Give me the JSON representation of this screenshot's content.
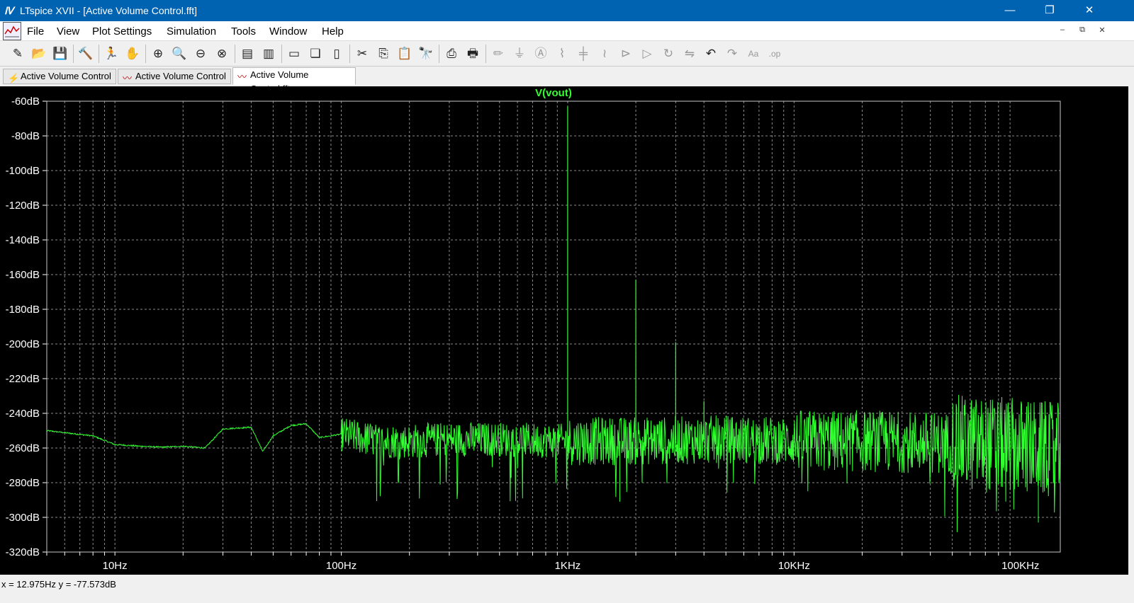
{
  "window": {
    "title": "LTspice XVII - [Active Volume Control.fft]",
    "app_icon": "ltspice-logo-icon"
  },
  "menu": {
    "items": [
      "File",
      "View",
      "Plot Settings",
      "Simulation",
      "Tools",
      "Window",
      "Help"
    ]
  },
  "toolbar": {
    "icons": [
      "new-schematic-icon",
      "open-icon",
      "save-icon",
      "control-panel-icon",
      "run-icon",
      "halt-icon",
      "zoom-in-icon",
      "zoom-area-icon",
      "zoom-out-icon",
      "zoom-fit-icon",
      "autorange-icon",
      "plot-settings-icon",
      "tile-horizontal-icon",
      "cascade-icon",
      "tile-vertical-icon",
      "cut-icon",
      "copy-icon",
      "paste-icon",
      "find-icon",
      "print-preview-icon",
      "print-icon",
      "wire-icon",
      "ground-icon",
      "label-icon",
      "resistor-icon",
      "capacitor-icon",
      "inductor-icon",
      "diode-icon",
      "component-icon",
      "rotate-icon",
      "mirror-icon",
      "undo-icon",
      "redo-icon",
      "text-icon",
      "spice-directive-icon"
    ]
  },
  "tabs": [
    {
      "label": "Active Volume Control",
      "icon": "schematic-icon"
    },
    {
      "label": "Active Volume Control",
      "icon": "waveform-icon"
    },
    {
      "label": "Active Volume Control.fft",
      "icon": "fft-icon"
    }
  ],
  "status": {
    "cursor_readout": "x = 12.975Hz    y = -77.573dB"
  },
  "colors": {
    "trace": "#33ff33",
    "grid": "#8a8a8a",
    "background": "#000000",
    "axis_text": "#ffffff"
  },
  "chart_data": {
    "type": "line",
    "title": "V(vout)",
    "xlabel": "",
    "ylabel": "",
    "x_scale": "log",
    "xlim": [
      5,
      150000
    ],
    "ylim": [
      -320,
      -60
    ],
    "grid": true,
    "x_tick_labels": [
      "10Hz",
      "100Hz",
      "1KHz",
      "10KHz",
      "100KHz"
    ],
    "x_tick_values": [
      10,
      100,
      1000,
      10000,
      100000
    ],
    "y_tick_labels": [
      "-60dB",
      "-80dB",
      "-100dB",
      "-120dB",
      "-140dB",
      "-160dB",
      "-180dB",
      "-200dB",
      "-220dB",
      "-240dB",
      "-260dB",
      "-280dB",
      "-300dB",
      "-320dB"
    ],
    "y_tick_values": [
      -60,
      -80,
      -100,
      -120,
      -140,
      -160,
      -180,
      -200,
      -220,
      -240,
      -260,
      -280,
      -300,
      -320
    ],
    "series": [
      {
        "name": "V(vout)",
        "baseline": {
          "x": [
            5,
            8,
            10,
            13,
            16,
            20,
            25,
            30,
            40,
            45,
            50,
            60,
            70,
            80,
            100,
            150,
            200,
            300,
            500,
            1000,
            2000,
            5000,
            10000,
            20000,
            50000,
            100000,
            150000
          ],
          "y": [
            -250,
            -253,
            -258,
            -259,
            -259.5,
            -259,
            -260,
            -249,
            -248,
            -262,
            -253,
            -247,
            -246,
            -254,
            -252,
            -256,
            -256,
            -255,
            -255,
            -256,
            -256,
            -255,
            -256,
            -256,
            -257,
            -259,
            -262
          ]
        },
        "peaks": [
          {
            "x": 1000,
            "y": -63
          },
          {
            "x": 2000,
            "y": -163
          },
          {
            "x": 3000,
            "y": -199
          },
          {
            "x": 4000,
            "y": -233
          }
        ],
        "dips": [
          {
            "x": 1700,
            "y": -291
          },
          {
            "x": 120000,
            "y": -303
          }
        ]
      }
    ]
  }
}
